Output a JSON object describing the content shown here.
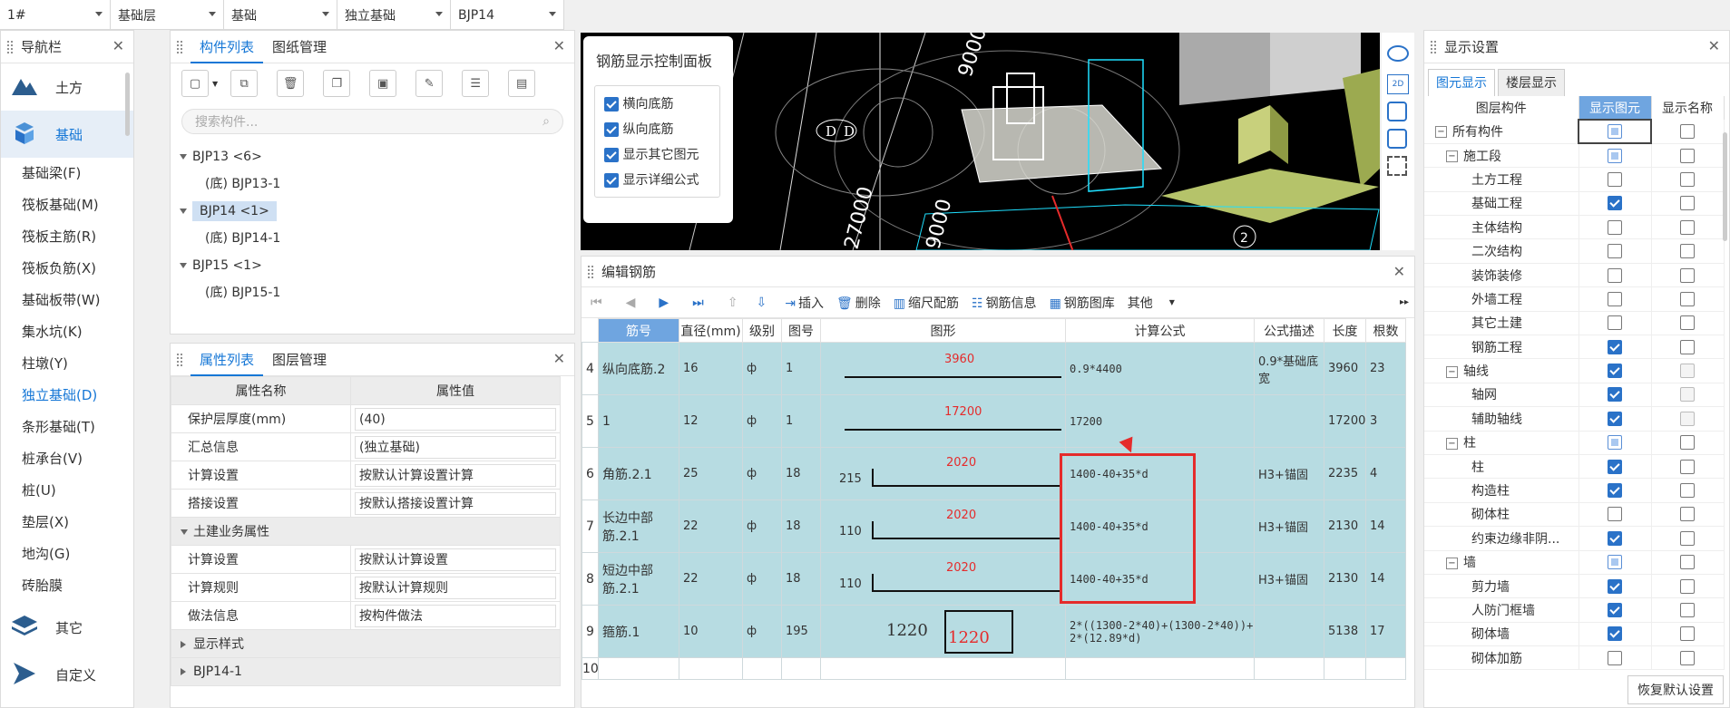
{
  "topbar": {
    "items": [
      {
        "label": "1#",
        "w": 122
      },
      {
        "label": "基础层",
        "w": 125
      },
      {
        "label": "基础",
        "w": 125
      },
      {
        "label": "独立基础",
        "w": 125
      },
      {
        "label": "BJP14",
        "w": 125
      }
    ]
  },
  "nav": {
    "title": "导航栏",
    "big": [
      {
        "label": "土方",
        "icon": "earthwork-icon"
      },
      {
        "label": "基础",
        "icon": "foundation-icon",
        "selected": true
      }
    ],
    "items": [
      "基础梁(F)",
      "筏板基础(M)",
      "筏板主筋(R)",
      "筏板负筋(X)",
      "基础板带(W)",
      "集水坑(K)",
      "柱墩(Y)",
      "独立基础(D)",
      "条形基础(T)",
      "桩承台(V)",
      "桩(U)",
      "垫层(X)",
      "地沟(G)",
      "砖胎膜"
    ],
    "selected_item": "独立基础(D)",
    "bottom": [
      {
        "label": "其它",
        "icon": "layers-icon"
      },
      {
        "label": "自定义",
        "icon": "custom-icon"
      }
    ]
  },
  "component_panel": {
    "tabs": [
      "构件列表",
      "图纸管理"
    ],
    "search_placeholder": "搜索构件...",
    "tree": [
      {
        "label": "BJP13 <6>",
        "child": "(底) BJP13-1"
      },
      {
        "label": "BJP14 <1>",
        "child": "(底) BJP14-1",
        "selected": true
      },
      {
        "label": "BJP15 <1>",
        "child": "(底) BJP15-1"
      }
    ]
  },
  "property_panel": {
    "tabs": [
      "属性列表",
      "图层管理"
    ],
    "headers": [
      "属性名称",
      "属性值"
    ],
    "rows": [
      {
        "name": "保护层厚度(mm)",
        "value": "(40)"
      },
      {
        "name": "汇总信息",
        "value": "(独立基础)"
      },
      {
        "name": "计算设置",
        "value": "按默认计算设置计算"
      },
      {
        "name": "搭接设置",
        "value": "按默认搭接设置计算"
      }
    ],
    "group1": "土建业务属性",
    "rows2": [
      {
        "name": "计算设置",
        "value": "按默认计算设置"
      },
      {
        "name": "计算规则",
        "value": "按默认计算规则"
      },
      {
        "name": "做法信息",
        "value": "按构件做法"
      }
    ],
    "group2": "显示样式",
    "group3": "BJP14-1"
  },
  "control_panel": {
    "title": "钢筋显示控制面板",
    "options": [
      "横向底筋",
      "纵向底筋",
      "显示其它图元",
      "显示详细公式"
    ]
  },
  "viewport_labels": {
    "dim1": "9000",
    "dim2": "27000",
    "dim3": "9000",
    "d1": "D",
    "d2": "D",
    "n2": "2"
  },
  "rebar_editor": {
    "title": "编辑钢筋",
    "toolbar": [
      "插入",
      "删除",
      "缩尺配筋",
      "钢筋信息",
      "钢筋图库",
      "其他"
    ],
    "headers": [
      "筋号",
      "直径(mm)",
      "级别",
      "图号",
      "图形",
      "计算公式",
      "公式描述",
      "长度",
      "根数"
    ],
    "rows": [
      {
        "no": "4",
        "name": "纵向底筋.2",
        "dia": "16",
        "grade": "ф",
        "fig": "1",
        "shape_left": "",
        "shape_val": "3960",
        "formula": "0.9*4400",
        "desc": "0.9*基础底宽",
        "len": "3960",
        "cnt": "23"
      },
      {
        "no": "5",
        "name": "1",
        "dia": "12",
        "grade": "ф",
        "fig": "1",
        "shape_left": "",
        "shape_val": "17200",
        "formula": "17200",
        "desc": "",
        "len": "17200",
        "cnt": "3"
      },
      {
        "no": "6",
        "name": "角筋.2.1",
        "dia": "25",
        "grade": "ф",
        "fig": "18",
        "shape_left": "215",
        "shape_val": "2020",
        "formula": "1400-40+35*d",
        "desc": "H3+锚固",
        "len": "2235",
        "cnt": "4"
      },
      {
        "no": "7",
        "name": "长边中部筋.2.1",
        "dia": "22",
        "grade": "ф",
        "fig": "18",
        "shape_left": "110",
        "shape_val": "2020",
        "formula": "1400-40+35*d",
        "desc": "H3+锚固",
        "len": "2130",
        "cnt": "14"
      },
      {
        "no": "8",
        "name": "短边中部筋.2.1",
        "dia": "22",
        "grade": "ф",
        "fig": "18",
        "shape_left": "110",
        "shape_val": "2020",
        "formula": "1400-40+35*d",
        "desc": "H3+锚固",
        "len": "2130",
        "cnt": "14"
      },
      {
        "no": "9",
        "name": "箍筋.1",
        "dia": "10",
        "grade": "ф",
        "fig": "195",
        "shape_left": "1220",
        "shape_val": "1220",
        "formula": "2*((1300-2*40)+(1300-2*40))+2*(12.89*d)",
        "desc": "",
        "len": "5138",
        "cnt": "17"
      }
    ],
    "last_row": "10"
  },
  "display_settings": {
    "title": "显示设置",
    "tabs": [
      "图元显示",
      "楼层显示"
    ],
    "headers": [
      "图层构件",
      "显示图元",
      "显示名称"
    ],
    "rows": [
      {
        "label": "所有构件",
        "lvl": 0,
        "exp": "-",
        "a": "ind",
        "b": "off"
      },
      {
        "label": "施工段",
        "lvl": 1,
        "exp": "-",
        "a": "ind",
        "b": "off"
      },
      {
        "label": "土方工程",
        "lvl": 2,
        "a": "off",
        "b": "off"
      },
      {
        "label": "基础工程",
        "lvl": 2,
        "a": "on",
        "b": "off"
      },
      {
        "label": "主体结构",
        "lvl": 2,
        "a": "off",
        "b": "off"
      },
      {
        "label": "二次结构",
        "lvl": 2,
        "a": "off",
        "b": "off"
      },
      {
        "label": "装饰装修",
        "lvl": 2,
        "a": "off",
        "b": "off"
      },
      {
        "label": "外墙工程",
        "lvl": 2,
        "a": "off",
        "b": "off"
      },
      {
        "label": "其它土建",
        "lvl": 2,
        "a": "off",
        "b": "off"
      },
      {
        "label": "钢筋工程",
        "lvl": 2,
        "a": "on",
        "b": "off"
      },
      {
        "label": "轴线",
        "lvl": 1,
        "exp": "-",
        "a": "on",
        "b": "dis"
      },
      {
        "label": "轴网",
        "lvl": 2,
        "a": "on",
        "b": "dis"
      },
      {
        "label": "辅助轴线",
        "lvl": 2,
        "a": "on",
        "b": "dis"
      },
      {
        "label": "柱",
        "lvl": 1,
        "exp": "-",
        "a": "ind",
        "b": "off"
      },
      {
        "label": "柱",
        "lvl": 2,
        "a": "on",
        "b": "off"
      },
      {
        "label": "构造柱",
        "lvl": 2,
        "a": "on",
        "b": "off"
      },
      {
        "label": "砌体柱",
        "lvl": 2,
        "a": "off",
        "b": "off"
      },
      {
        "label": "约束边缘非阴...",
        "lvl": 2,
        "a": "on",
        "b": "off"
      },
      {
        "label": "墙",
        "lvl": 1,
        "exp": "-",
        "a": "ind",
        "b": "off"
      },
      {
        "label": "剪力墙",
        "lvl": 2,
        "a": "on",
        "b": "off"
      },
      {
        "label": "人防门框墙",
        "lvl": 2,
        "a": "on",
        "b": "off"
      },
      {
        "label": "砌体墙",
        "lvl": 2,
        "a": "on",
        "b": "off"
      },
      {
        "label": "砌体加筋",
        "lvl": 2,
        "a": "off",
        "b": "off"
      }
    ],
    "reset_label": "恢复默认设置"
  },
  "colors": {
    "accent": "#1677d6",
    "row_bg": "#b7dce2",
    "highlight": "#e52b2b"
  }
}
